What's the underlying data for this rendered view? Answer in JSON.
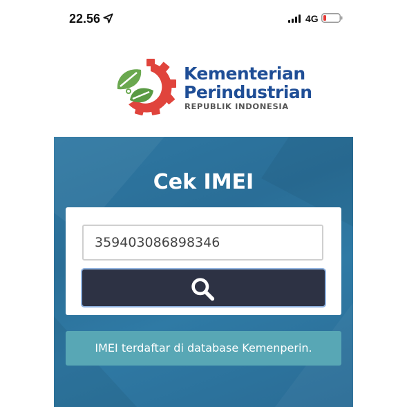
{
  "status_bar": {
    "time": "22.56",
    "network": "4G",
    "icons": [
      "location-arrow-icon",
      "signal-bars-icon",
      "battery-low-icon"
    ],
    "battery_color": "#e53935"
  },
  "logo": {
    "line1": "Kementerian",
    "line2": "Perindustrian",
    "line3": "REPUBLIK INDONESIA",
    "gear_color": "#e0443c",
    "leaf_color": "#6aa84f",
    "text_color": "#1f4e96"
  },
  "card": {
    "title": "Cek IMEI",
    "imei_value": "359403086898346",
    "search_button_icon": "search-icon",
    "result_message": "IMEI terdaftar di database Kemenperin.",
    "colors": {
      "card_bg": "#2f78a3",
      "button_bg": "#2d3244",
      "result_bg": "#58a7b5"
    }
  }
}
